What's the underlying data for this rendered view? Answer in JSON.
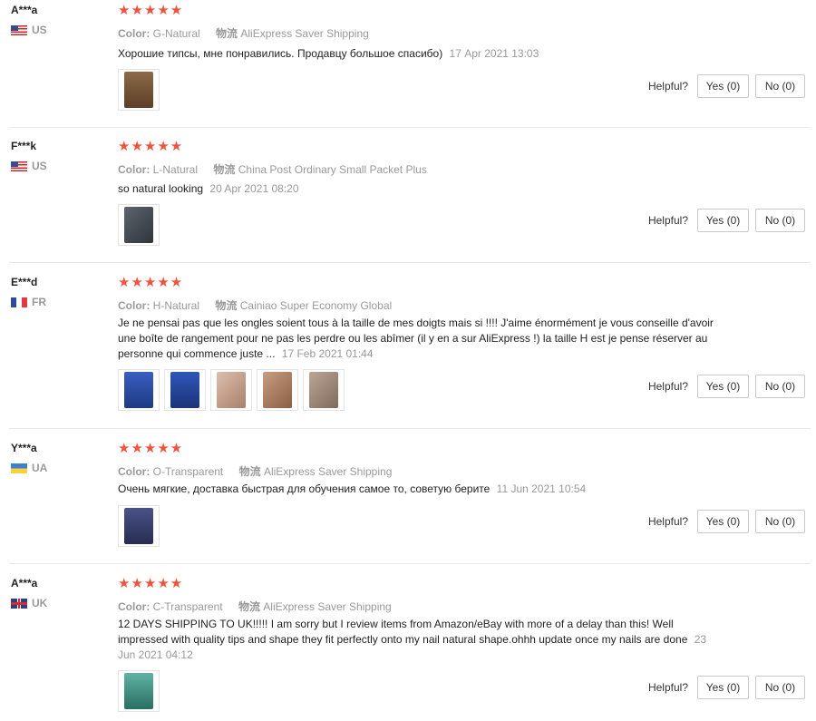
{
  "reviews": [
    {
      "user": "A***a",
      "country_code": "US",
      "flag_icon": "us-flag-icon",
      "rating": 5,
      "stars_text": "★★★★★",
      "color_label": "Color:",
      "color_value": "G-Natural",
      "shipping_label": "物流",
      "shipping_value": "AliExpress Saver Shipping",
      "text": "Хорошие типсы, мне понравились. Продавцу большое спасибо)",
      "date": "17 Apr 2021 13:03",
      "photos": [
        {
          "icon": "nail-tips-photo",
          "color": "#7a5a3c"
        }
      ],
      "helpful_label": "Helpful?",
      "yes_label": "Yes (0)",
      "no_label": "No (0)"
    },
    {
      "user": "F***k",
      "country_code": "US",
      "flag_icon": "us-flag-icon",
      "rating": 5,
      "stars_text": "★★★★★",
      "color_label": "Color:",
      "color_value": "L-Natural",
      "shipping_label": "物流",
      "shipping_value": "China Post Ordinary Small Packet Plus",
      "text": "so natural looking",
      "date": "20 Apr 2021 08:20",
      "photos": [
        {
          "icon": "hand-photo",
          "color": "#4a5058"
        }
      ],
      "helpful_label": "Helpful?",
      "yes_label": "Yes (0)",
      "no_label": "No (0)"
    },
    {
      "user": "E***d",
      "country_code": "FR",
      "flag_icon": "fr-flag-icon",
      "rating": 5,
      "stars_text": "★★★★★",
      "color_label": "Color:",
      "color_value": "H-Natural",
      "shipping_label": "物流",
      "shipping_value": "Cainiao Super Economy Global",
      "text": "Je ne pensai pas que les ongles soient tous à la taille de mes doigts mais si !!!! J'aime énormément je vous conseille d'avoir une boîte de rangement pour ne pas les perdre ou les abîmer (il y en a sur AliExpress !) la taille H est je pense réserver au personne qui commence juste ...",
      "date": "17 Feb 2021 01:44",
      "photos": [
        {
          "icon": "nail-box-photo",
          "color": "#2f4fa6"
        },
        {
          "icon": "nail-box-photo",
          "color": "#274a9c"
        },
        {
          "icon": "hand-photo",
          "color": "#c9a48c"
        },
        {
          "icon": "hand-photo",
          "color": "#b98a6c"
        },
        {
          "icon": "hand-photo",
          "color": "#a58d7a"
        }
      ],
      "helpful_label": "Helpful?",
      "yes_label": "Yes (0)",
      "no_label": "No (0)"
    },
    {
      "user": "Y***a",
      "country_code": "UA",
      "flag_icon": "ua-flag-icon",
      "rating": 5,
      "stars_text": "★★★★★",
      "color_label": "Color:",
      "color_value": "O-Transparent",
      "shipping_label": "物流",
      "shipping_value": "AliExpress Saver Shipping",
      "text": "Очень мягкие, доставка быстрая для обучения самое то, советую берите",
      "date": "11 Jun 2021 10:54",
      "photos": [
        {
          "icon": "nail-tips-photo",
          "color": "#3c4470"
        }
      ],
      "helpful_label": "Helpful?",
      "yes_label": "Yes (0)",
      "no_label": "No (0)"
    },
    {
      "user": "A***a",
      "country_code": "UK",
      "flag_icon": "uk-flag-icon",
      "rating": 5,
      "stars_text": "★★★★★",
      "color_label": "Color:",
      "color_value": "C-Transparent",
      "shipping_label": "物流",
      "shipping_value": "AliExpress Saver Shipping",
      "text": "12 DAYS SHIPPING TO UK!!!!! I am sorry but I review items from Amazon/eBay with more of a delay than this! Well impressed with quality tips and shape they fit perfectly onto my nail natural shape.ohhh update once my nails are done",
      "date": "23 Jun 2021 04:12",
      "photos": [
        {
          "icon": "nail-tips-photo",
          "color": "#3f8f82"
        }
      ],
      "helpful_label": "Helpful?",
      "yes_label": "Yes (0)",
      "no_label": "No (0)"
    }
  ],
  "colors": {
    "star": "#f2523c",
    "muted": "#999999",
    "divider": "#e8e8e8"
  }
}
